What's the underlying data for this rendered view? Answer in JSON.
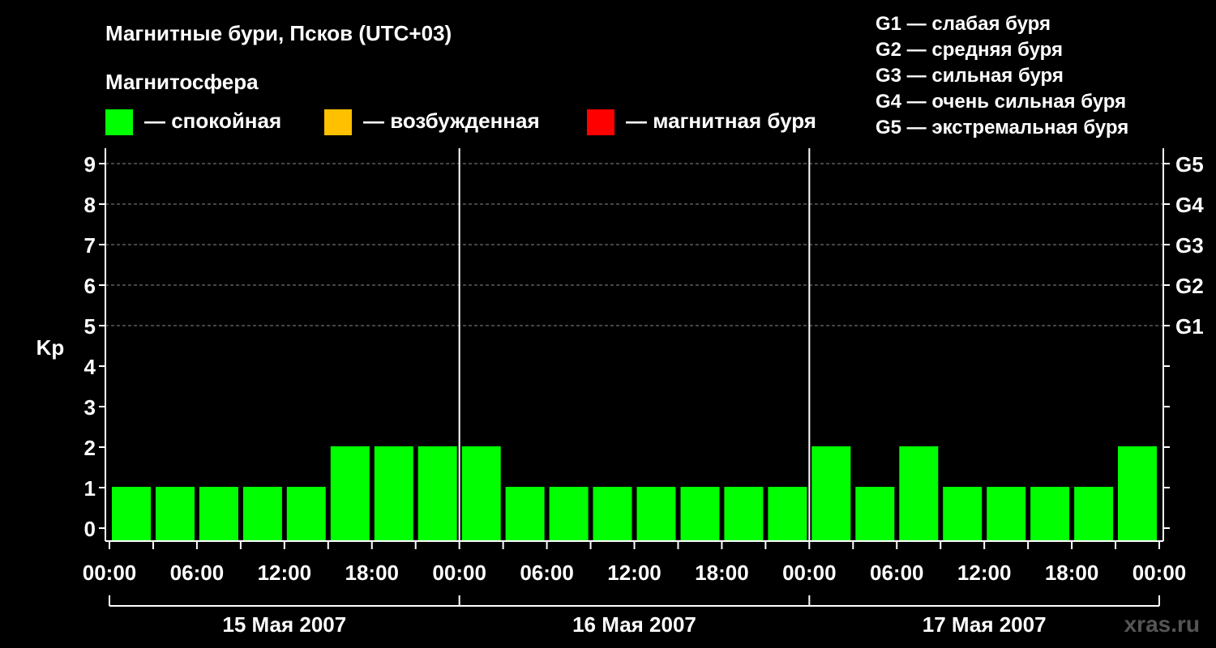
{
  "chart_data": {
    "type": "bar",
    "title": "Магнитные бури, Псков (UTC+03)",
    "subtitle": "Магнитосфера",
    "ylabel": "Kp",
    "ylim": [
      0,
      9
    ],
    "yticks": [
      "0",
      "1",
      "2",
      "3",
      "4",
      "5",
      "6",
      "7",
      "8",
      "9"
    ],
    "right_axis_labels": [
      {
        "kp": 5,
        "label": "G1"
      },
      {
        "kp": 6,
        "label": "G2"
      },
      {
        "kp": 7,
        "label": "G3"
      },
      {
        "kp": 8,
        "label": "G4"
      },
      {
        "kp": 9,
        "label": "G5"
      }
    ],
    "grid": "dashed horizontal at Kp 5–9",
    "legend": [
      {
        "label": "— спокойная",
        "color": "#00ff00"
      },
      {
        "label": "— возбужденная",
        "color": "#ffc000"
      },
      {
        "label": "— магнитная буря",
        "color": "#ff0000"
      }
    ],
    "severity_legend": [
      "G1 — слабая буря",
      "G2 — средняя буря",
      "G3 — сильная буря",
      "G4 — очень сильная буря",
      "G5 — экстремальная буря"
    ],
    "xticks": [
      "00:00",
      "06:00",
      "12:00",
      "18:00",
      "00:00",
      "06:00",
      "12:00",
      "18:00",
      "00:00",
      "06:00",
      "12:00",
      "18:00",
      "00:00"
    ],
    "days": [
      "15 Мая 2007",
      "16 Мая 2007",
      "17 Мая 2007"
    ],
    "interval_hours": 3,
    "bar_color": "#00ff00",
    "values": [
      1,
      1,
      1,
      1,
      1,
      2,
      2,
      2,
      2,
      1,
      1,
      1,
      1,
      1,
      1,
      1,
      2,
      1,
      2,
      1,
      1,
      1,
      1,
      2
    ]
  },
  "brand": "xras.ru"
}
